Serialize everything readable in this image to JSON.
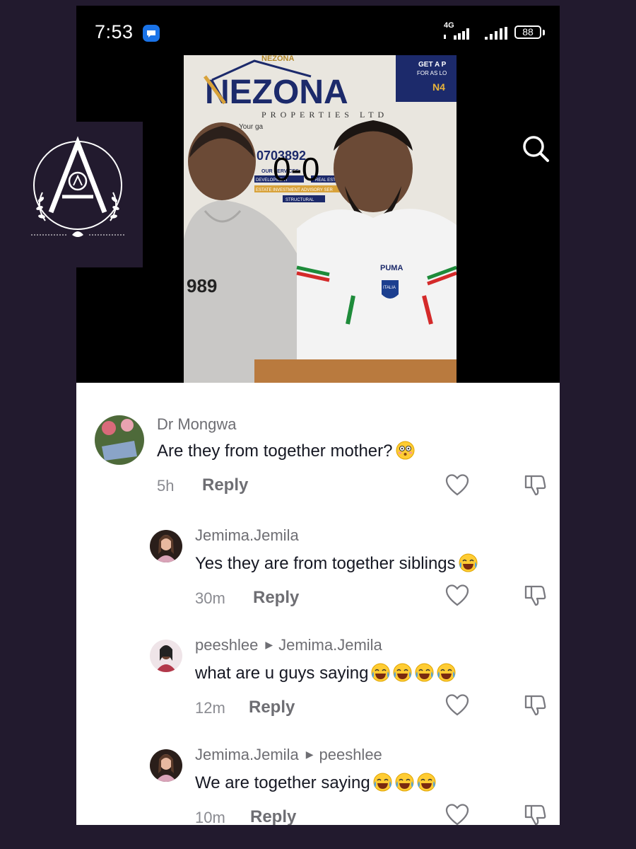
{
  "status_bar": {
    "time": "7:53",
    "network": "4G",
    "battery": "88"
  },
  "video": {
    "score_text": "0-0",
    "banner": {
      "brand": "NEZONA",
      "sub": "PROPERTIES LTD",
      "tagline": "Your ga",
      "phone": "CT: 0703892",
      "services_title": "OUR SERVICES:",
      "service_1": "DEVELOPMENT",
      "service_2": "REAL ESTATE",
      "service_3": "ESTATE INVESTMENT ADVISORY SER",
      "service_4": "STRUCTURAL",
      "promo_1": "GET A P",
      "promo_2": "FOR AS LO",
      "promo_3": "N4",
      "hoodie_text": "989",
      "jersey_brand": "PUMA",
      "jersey_badge": "ITALIA"
    }
  },
  "comments": [
    {
      "user": "Dr Mongwa",
      "reply_to": "",
      "text": "Are they from together mother?",
      "emoji": [
        "flushed"
      ],
      "time": "5h",
      "reply_label": "Reply"
    },
    {
      "user": "Jemima.Jemila",
      "reply_to": "",
      "text": "Yes they are from together siblings",
      "emoji": [
        "laughing"
      ],
      "time": "30m",
      "reply_label": "Reply"
    },
    {
      "user": "peeshlee",
      "reply_to": "Jemima.Jemila",
      "text": "what are u guys saying",
      "emoji": [
        "laughing",
        "laughing",
        "laughing",
        "laughing"
      ],
      "time": "12m",
      "reply_label": "Reply"
    },
    {
      "user": "Jemima.Jemila",
      "reply_to": "peeshlee",
      "text": "We are together saying",
      "emoji": [
        "laughing",
        "laughing",
        "laughing"
      ],
      "time": "10m",
      "reply_label": "Reply"
    }
  ],
  "icons": {
    "search": "search-icon",
    "like": "heart-icon",
    "dislike": "thumbs-down-icon",
    "message_app": "message-app-icon",
    "logo": "brand-logo-icon"
  },
  "colors": {
    "page_bg": "#221a2e",
    "accent_blue": "#1a73e8",
    "text_primary": "#161823",
    "text_secondary": "#6e6e73"
  }
}
